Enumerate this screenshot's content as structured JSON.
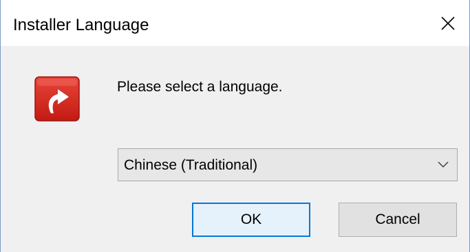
{
  "window": {
    "title": "Installer Language",
    "close_icon": "close-icon",
    "border_color": "#7a9bc4"
  },
  "dialog": {
    "app_icon": "installer-arrow-icon",
    "app_icon_color": "#d9261c",
    "prompt": "Please select a language.",
    "language_select": {
      "selected": "Chinese (Traditional)",
      "arrow_icon": "chevron-down-icon"
    },
    "buttons": {
      "ok_label": "OK",
      "cancel_label": "Cancel",
      "focus_color": "#0078d7"
    }
  }
}
